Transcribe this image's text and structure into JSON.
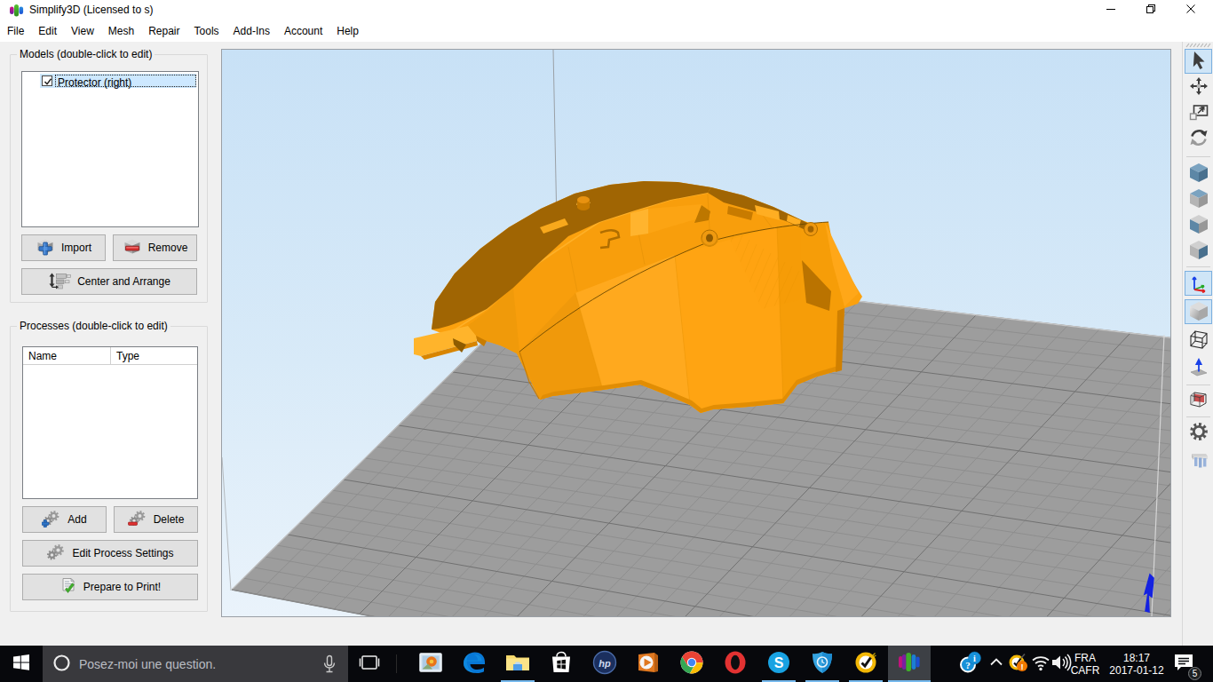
{
  "window": {
    "title": "Simplify3D (Licensed to s)",
    "app_icon": "simplify3d-logo",
    "controls": {
      "minimize": "minimize",
      "restore": "restore",
      "close": "close"
    }
  },
  "menu": {
    "items": [
      "File",
      "Edit",
      "View",
      "Mesh",
      "Repair",
      "Tools",
      "Add-Ins",
      "Account",
      "Help"
    ]
  },
  "models_panel": {
    "label": "Models (double-click to edit)",
    "items": [
      {
        "name": "Protector (right)",
        "checked": true,
        "selected": true
      }
    ],
    "buttons": {
      "import": "Import",
      "remove": "Remove",
      "center_arrange": "Center and Arrange"
    }
  },
  "processes_panel": {
    "label": "Processes (double-click to edit)",
    "columns": {
      "name": "Name",
      "type": "Type"
    },
    "rows": [],
    "buttons": {
      "add": "Add",
      "delete": "Delete",
      "edit": "Edit Process Settings",
      "prepare": "Prepare to Print!"
    }
  },
  "viewport": {
    "model": "Protector (right)",
    "colors": {
      "sky_top": "#c9e2f6",
      "sky_bottom": "#e9f3fb",
      "plate": "#9d9d9d",
      "grid_minor": "#8e8e8e",
      "grid_major": "#717171",
      "model_orange": "#ffa412",
      "model_dark": "#a06503",
      "z_axis": "#1522e0"
    }
  },
  "right_toolbar": {
    "tools": [
      "select",
      "move",
      "scale",
      "rotate",
      "view-iso",
      "view-top",
      "view-front",
      "view-side",
      "coordinate-axes",
      "solid-render",
      "wireframe-render",
      "surface-normals",
      "cross-section",
      "machine-settings",
      "support-structures"
    ],
    "selected": [
      "select",
      "coordinate-axes",
      "solid-render"
    ]
  },
  "taskbar": {
    "search": {
      "placeholder": "Posez-moi une question."
    },
    "apps": [
      {
        "name": "photos",
        "running": false
      },
      {
        "name": "edge",
        "running": false
      },
      {
        "name": "file-explorer",
        "running": true
      },
      {
        "name": "windows-store",
        "running": false
      },
      {
        "name": "hp",
        "running": false
      },
      {
        "name": "media-player",
        "running": false
      },
      {
        "name": "chrome",
        "running": false
      },
      {
        "name": "opera",
        "running": false
      },
      {
        "name": "skype",
        "running": true
      },
      {
        "name": "shield-utility",
        "running": true
      },
      {
        "name": "norton",
        "running": true
      },
      {
        "name": "simplify3d",
        "running": true,
        "active": true
      }
    ],
    "tray": {
      "language": {
        "line1": "FRA",
        "line2": "CAFR"
      },
      "clock": {
        "time": "18:17",
        "date": "2017-01-12"
      },
      "notification_count": "5"
    }
  }
}
